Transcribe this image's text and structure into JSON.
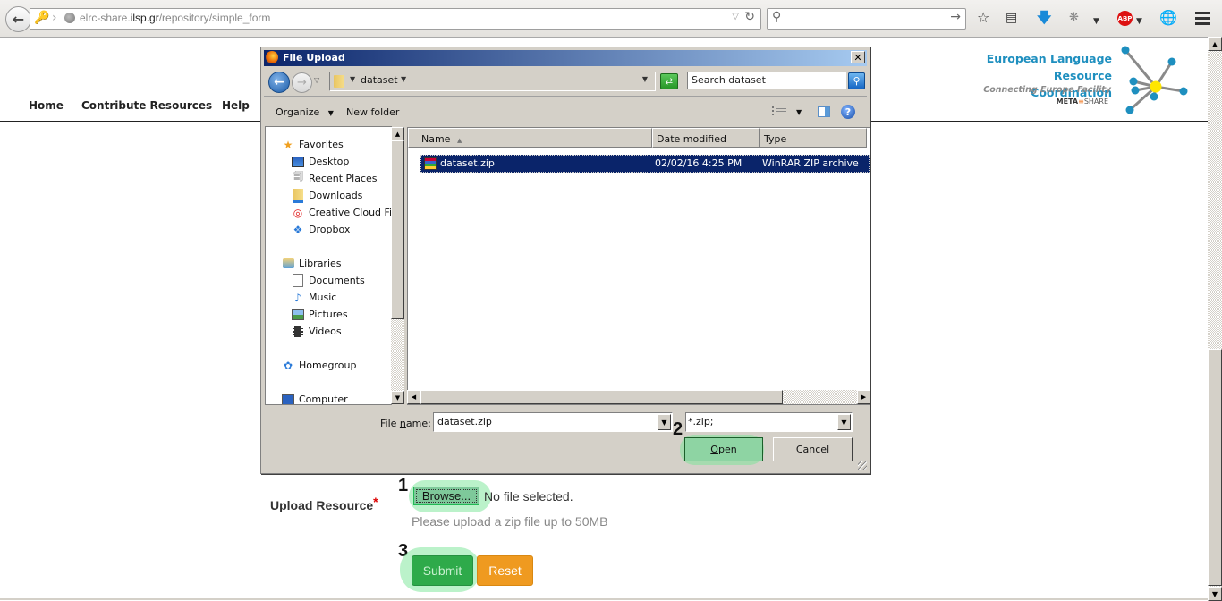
{
  "browser": {
    "url_prefix": "elrc-share.",
    "url_domain": "ilsp.gr",
    "url_path": "/repository/simple_form",
    "search_placeholder": "",
    "icons": [
      "back-icon",
      "key-icon",
      "globe-icon",
      "reload-icon",
      "search-icon",
      "go-arrow-icon",
      "bookmark-star-icon",
      "reading-list-icon",
      "download-icon",
      "extension-bug-icon",
      "abp-icon",
      "globe-edit-icon",
      "menu-icon"
    ],
    "abp_label": "ABP"
  },
  "nav": {
    "items": [
      {
        "label": "Home"
      },
      {
        "label": "Contribute Resources"
      },
      {
        "label": "Help"
      }
    ]
  },
  "logo": {
    "line1": "European Language",
    "line2": "Resource Coordination",
    "subtitle": "Connecting Europe Facility",
    "meta_bold": "META",
    "meta_rest": "SHARE",
    "colors": {
      "text": "#1e8fbf",
      "node": "#1e8fbf",
      "center": "#ffe600"
    }
  },
  "dialog": {
    "title": "File Upload",
    "path": "dataset",
    "search_placeholder": "Search dataset",
    "toolbar": {
      "organize": "Organize",
      "new_folder": "New folder"
    },
    "nav_pane": {
      "favorites": {
        "label": "Favorites",
        "items": [
          "Desktop",
          "Recent Places",
          "Downloads",
          "Creative Cloud File",
          "Dropbox"
        ]
      },
      "libraries": {
        "label": "Libraries",
        "items": [
          "Documents",
          "Music",
          "Pictures",
          "Videos"
        ]
      },
      "homegroup": "Homegroup",
      "computer": "Computer"
    },
    "columns": [
      "Name",
      "Date modified",
      "Type"
    ],
    "files": [
      {
        "name": "dataset.zip",
        "date_modified": "02/02/16 4:25 PM",
        "type": "WinRAR ZIP archive",
        "selected": true
      }
    ],
    "file_name_label_pre": "File ",
    "file_name_label_u": "n",
    "file_name_label_post": "ame:",
    "file_name_value": "dataset.zip",
    "file_type_value": "*.zip;",
    "open_u": "O",
    "open_rest": "pen",
    "cancel": "Cancel"
  },
  "form": {
    "upload_label": "Upload Resource",
    "required_mark": "*",
    "browse": "Browse...",
    "no_file": "No file selected.",
    "hint": "Please upload a zip file up to 50MB",
    "submit": "Submit",
    "reset": "Reset"
  },
  "annotations": {
    "step1": "1",
    "step2": "2",
    "step3": "3",
    "highlight_color": "#78e696"
  }
}
